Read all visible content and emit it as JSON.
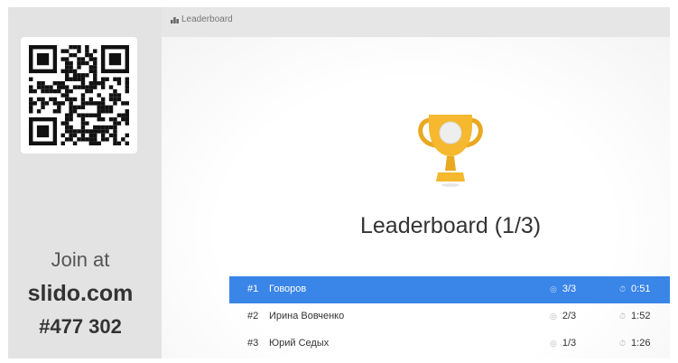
{
  "header": {
    "crumb_icon": "leaderboard-icon",
    "crumb_label": "Leaderboard"
  },
  "sidebar": {
    "join_label": "Join at",
    "join_site": "slido.com",
    "event_code": "#477 302"
  },
  "main": {
    "trophy_icon": "trophy-icon",
    "title": "Leaderboard (1/3)"
  },
  "leaderboard": {
    "rows": [
      {
        "rank": "#1",
        "name": "Говоров",
        "score": "3/3",
        "time": "0:51",
        "highlighted": true
      },
      {
        "rank": "#2",
        "name": "Ирина Вовченко",
        "score": "2/3",
        "time": "1:52",
        "highlighted": false
      },
      {
        "rank": "#3",
        "name": "Юрий Седых",
        "score": "1/3",
        "time": "1:26",
        "highlighted": false
      }
    ]
  },
  "colors": {
    "highlight": "#3a85e8",
    "trophy_gold": "#f5b82e"
  }
}
